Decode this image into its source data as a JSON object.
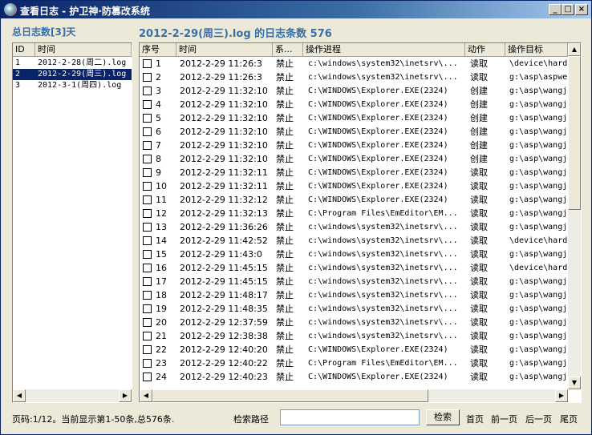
{
  "window": {
    "title": "查看日志 - 护卫神·防篡改系统",
    "min_icon": "minimize-icon",
    "max_icon": "maximize-icon",
    "close_icon": "close-icon"
  },
  "side": {
    "heading": "总日志数[3]天",
    "columns": [
      "ID",
      "时间"
    ],
    "rows": [
      {
        "id": "1",
        "time": "2012-2-28(周二).log"
      },
      {
        "id": "2",
        "time": "2012-2-29(周三).log"
      },
      {
        "id": "3",
        "time": "2012-3-1(周四).log"
      }
    ]
  },
  "main": {
    "heading": "2012-2-29(周三).log 的日志条数 576",
    "columns": [
      "序号",
      "时间",
      "系...",
      "操作进程",
      "动作",
      "操作目标"
    ],
    "rows": [
      {
        "n": "1",
        "time": "2012-2-29 11:26:3",
        "sys": "禁止",
        "proc": "c:\\windows\\system32\\inetsrv\\...",
        "act": "读取",
        "target": "\\device\\hard"
      },
      {
        "n": "2",
        "time": "2012-2-29 11:26:3",
        "sys": "禁止",
        "proc": "c:\\windows\\system32\\inetsrv\\...",
        "act": "读取",
        "target": "g:\\asp\\aspwe"
      },
      {
        "n": "3",
        "time": "2012-2-29 11:32:10",
        "sys": "禁止",
        "proc": "C:\\WINDOWS\\Explorer.EXE(2324)",
        "act": "创建",
        "target": "g:\\asp\\wangj"
      },
      {
        "n": "4",
        "time": "2012-2-29 11:32:10",
        "sys": "禁止",
        "proc": "C:\\WINDOWS\\Explorer.EXE(2324)",
        "act": "创建",
        "target": "g:\\asp\\wangj"
      },
      {
        "n": "5",
        "time": "2012-2-29 11:32:10",
        "sys": "禁止",
        "proc": "C:\\WINDOWS\\Explorer.EXE(2324)",
        "act": "创建",
        "target": "g:\\asp\\wangj"
      },
      {
        "n": "6",
        "time": "2012-2-29 11:32:10",
        "sys": "禁止",
        "proc": "C:\\WINDOWS\\Explorer.EXE(2324)",
        "act": "创建",
        "target": "g:\\asp\\wangj"
      },
      {
        "n": "7",
        "time": "2012-2-29 11:32:10",
        "sys": "禁止",
        "proc": "C:\\WINDOWS\\Explorer.EXE(2324)",
        "act": "创建",
        "target": "g:\\asp\\wangj"
      },
      {
        "n": "8",
        "time": "2012-2-29 11:32:10",
        "sys": "禁止",
        "proc": "C:\\WINDOWS\\Explorer.EXE(2324)",
        "act": "创建",
        "target": "g:\\asp\\wangj"
      },
      {
        "n": "9",
        "time": "2012-2-29 11:32:11",
        "sys": "禁止",
        "proc": "C:\\WINDOWS\\Explorer.EXE(2324)",
        "act": "读取",
        "target": "g:\\asp\\wangj"
      },
      {
        "n": "10",
        "time": "2012-2-29 11:32:11",
        "sys": "禁止",
        "proc": "C:\\WINDOWS\\Explorer.EXE(2324)",
        "act": "读取",
        "target": "g:\\asp\\wangj"
      },
      {
        "n": "11",
        "time": "2012-2-29 11:32:12",
        "sys": "禁止",
        "proc": "C:\\WINDOWS\\Explorer.EXE(2324)",
        "act": "读取",
        "target": "g:\\asp\\wangj"
      },
      {
        "n": "12",
        "time": "2012-2-29 11:32:13",
        "sys": "禁止",
        "proc": "C:\\Program Files\\EmEditor\\EM...",
        "act": "读取",
        "target": "g:\\asp\\wangj"
      },
      {
        "n": "13",
        "time": "2012-2-29 11:36:26",
        "sys": "禁止",
        "proc": "c:\\windows\\system32\\inetsrv\\...",
        "act": "读取",
        "target": "g:\\asp\\wangj"
      },
      {
        "n": "14",
        "time": "2012-2-29 11:42:52",
        "sys": "禁止",
        "proc": "c:\\windows\\system32\\inetsrv\\...",
        "act": "读取",
        "target": "\\device\\hard"
      },
      {
        "n": "15",
        "time": "2012-2-29 11:43:0",
        "sys": "禁止",
        "proc": "c:\\windows\\system32\\inetsrv\\...",
        "act": "读取",
        "target": "g:\\asp\\wangj"
      },
      {
        "n": "16",
        "time": "2012-2-29 11:45:15",
        "sys": "禁止",
        "proc": "c:\\windows\\system32\\inetsrv\\...",
        "act": "读取",
        "target": "\\device\\hard"
      },
      {
        "n": "17",
        "time": "2012-2-29 11:45:15",
        "sys": "禁止",
        "proc": "c:\\windows\\system32\\inetsrv\\...",
        "act": "读取",
        "target": "g:\\asp\\wangj"
      },
      {
        "n": "18",
        "time": "2012-2-29 11:48:17",
        "sys": "禁止",
        "proc": "c:\\windows\\system32\\inetsrv\\...",
        "act": "读取",
        "target": "g:\\asp\\wangj"
      },
      {
        "n": "19",
        "time": "2012-2-29 11:48:35",
        "sys": "禁止",
        "proc": "c:\\windows\\system32\\inetsrv\\...",
        "act": "读取",
        "target": "g:\\asp\\wangj"
      },
      {
        "n": "20",
        "time": "2012-2-29 12:37:59",
        "sys": "禁止",
        "proc": "c:\\windows\\system32\\inetsrv\\...",
        "act": "读取",
        "target": "g:\\asp\\wangj"
      },
      {
        "n": "21",
        "time": "2012-2-29 12:38:38",
        "sys": "禁止",
        "proc": "c:\\windows\\system32\\inetsrv\\...",
        "act": "读取",
        "target": "g:\\asp\\wangj"
      },
      {
        "n": "22",
        "time": "2012-2-29 12:40:20",
        "sys": "禁止",
        "proc": "C:\\WINDOWS\\Explorer.EXE(2324)",
        "act": "读取",
        "target": "g:\\asp\\wangj"
      },
      {
        "n": "23",
        "time": "2012-2-29 12:40:22",
        "sys": "禁止",
        "proc": "C:\\Program Files\\EmEditor\\EM...",
        "act": "读取",
        "target": "g:\\asp\\wangj"
      },
      {
        "n": "24",
        "time": "2012-2-29 12:40:23",
        "sys": "禁止",
        "proc": "C:\\WINDOWS\\Explorer.EXE(2324)",
        "act": "读取",
        "target": "g:\\asp\\wangj"
      }
    ]
  },
  "footer": {
    "page_info": "页码:1/12。当前显示第1-50条,总576条.",
    "search_label": "检索路径",
    "search_value": "",
    "search_button": "检索",
    "first": "首页",
    "prev": "前一页",
    "next": "后一页",
    "last": "尾页"
  },
  "colors": {
    "accent": "#3a6ea5",
    "selection": "#0a246a"
  }
}
